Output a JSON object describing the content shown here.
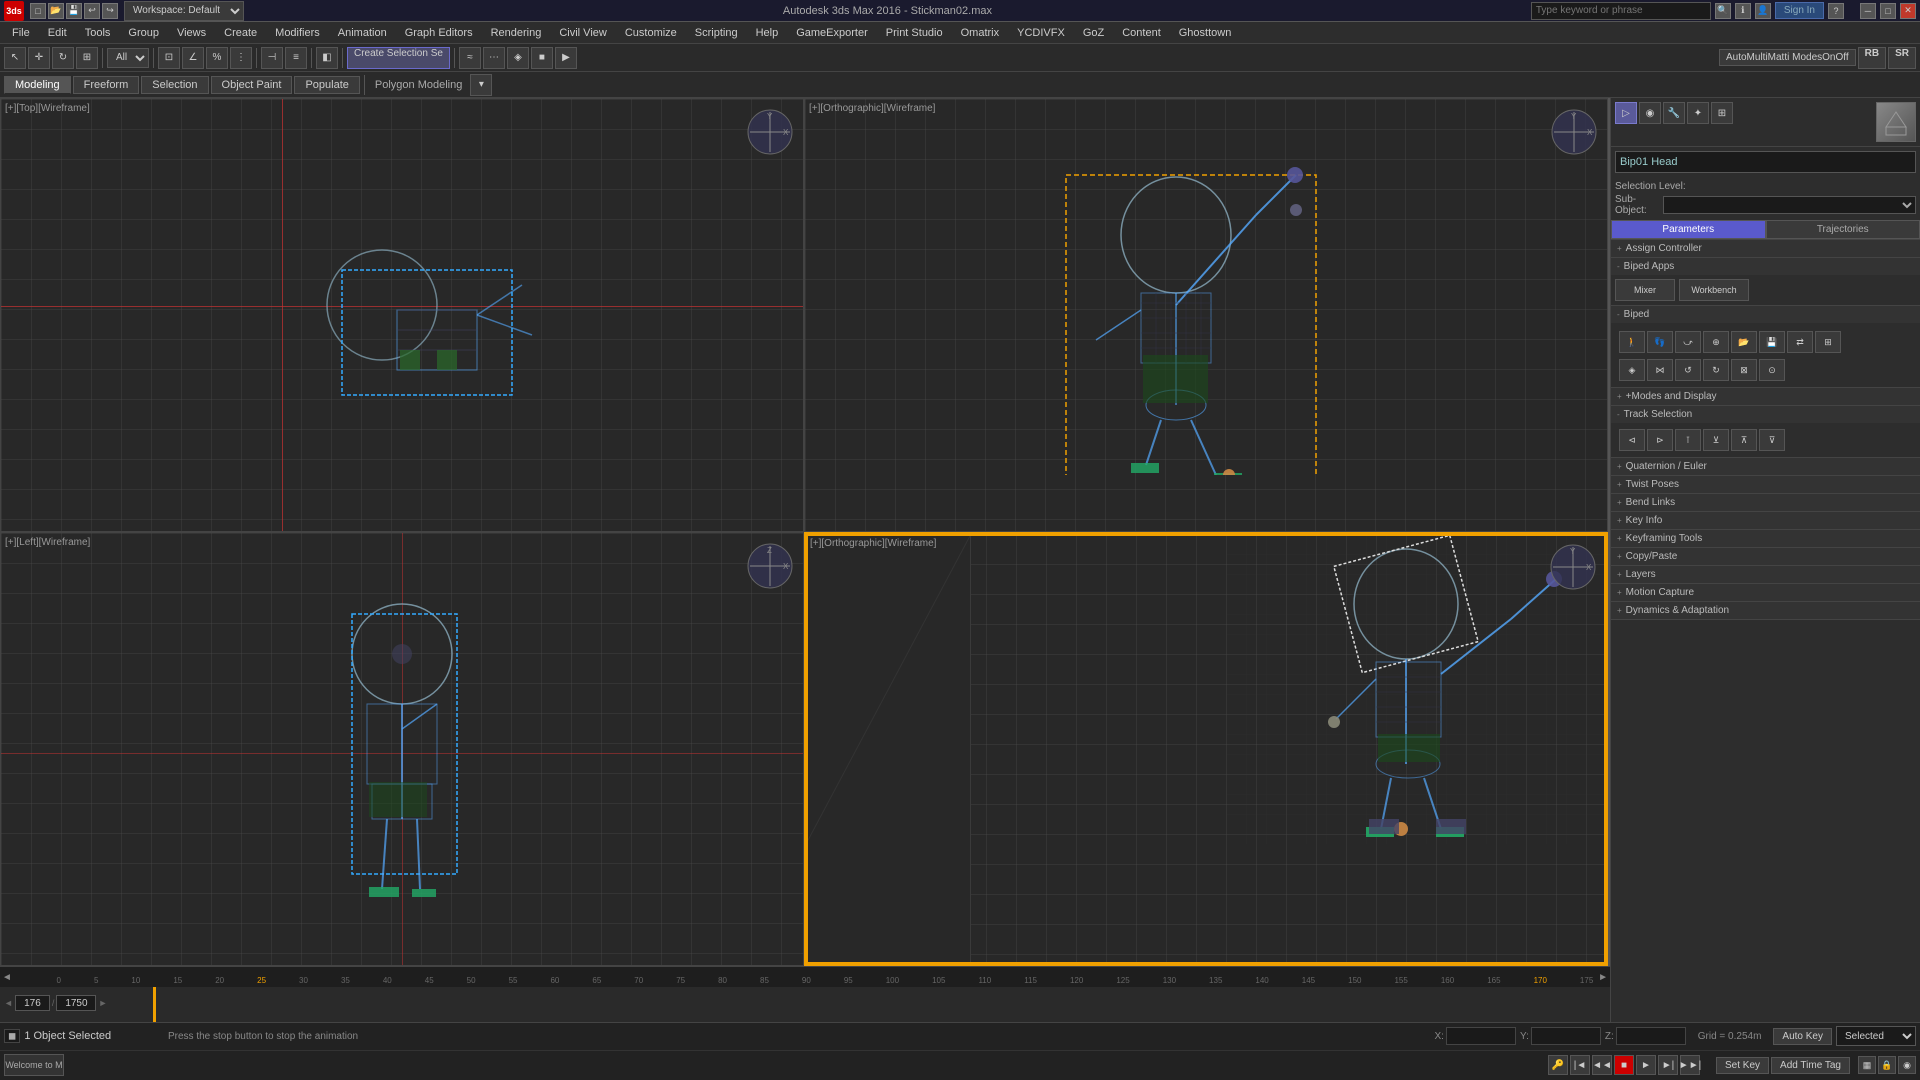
{
  "app": {
    "title": "Autodesk 3ds Max 2016 - Stickman02.max"
  },
  "titlebar": {
    "logo": "3ds",
    "workspace_label": "Workspace: Default",
    "search_placeholder": "Type keyword or phrase",
    "sign_in": "Sign In",
    "close": "✕",
    "maximize": "□",
    "minimize": "─",
    "help": "?"
  },
  "menubar": {
    "items": [
      "File",
      "Edit",
      "Tools",
      "Group",
      "Views",
      "Create",
      "Modifiers",
      "Animation",
      "Graph Editors",
      "Rendering",
      "Civil View",
      "Customize",
      "Scripting",
      "Help",
      "GameExporter",
      "Print Studio",
      "Omatrix",
      "YCDIVFX",
      "GoZ",
      "Content",
      "Ghosttown"
    ]
  },
  "toolbar": {
    "workspace": "Workspace: Default",
    "view_dropdown": "All",
    "create_selection": "Create Selection Se",
    "rb_btn": "RB",
    "sr_btn": "SR",
    "modes_btn": "AutoMultiMatti ModesOnOff"
  },
  "subtoolbar": {
    "tabs": [
      "Modeling",
      "Freeform",
      "Selection",
      "Object Paint",
      "Populate"
    ],
    "active_tab": "Modeling",
    "sub_label": "Polygon Modeling"
  },
  "viewports": [
    {
      "id": "vp-topleft",
      "label": "[+][Top][Wireframe]",
      "active": false,
      "position": "top-left"
    },
    {
      "id": "vp-topright",
      "label": "[+][Orthographic][Wireframe]",
      "active": false,
      "position": "top-right"
    },
    {
      "id": "vp-bottomleft",
      "label": "[+][Left][Wireframe]",
      "active": false,
      "position": "bottom-left"
    },
    {
      "id": "vp-bottomright",
      "label": "[+][Orthographic][Wireframe]",
      "active": true,
      "position": "bottom-right"
    }
  ],
  "right_panel": {
    "object_name": "Bip01 Head",
    "selection_level_label": "Selection Level:",
    "sub_object_label": "Sub-Object:",
    "tabs": [
      "Parameters",
      "Trajectories"
    ],
    "active_tab": "Parameters",
    "sections": [
      {
        "label": "Assign Controller",
        "expanded": false
      },
      {
        "label": "Biped Apps",
        "expanded": false
      },
      {
        "label": "Mixer",
        "expanded": false
      },
      {
        "label": "Workbench",
        "expanded": false
      },
      {
        "label": "Biped",
        "expanded": true
      },
      {
        "label": "+Modes and Display",
        "expanded": true
      },
      {
        "label": "Track Selection",
        "expanded": true
      },
      {
        "label": "Quaternion / Euler",
        "expanded": false
      },
      {
        "label": "Twist Poses",
        "expanded": false
      },
      {
        "label": "Bend Links",
        "expanded": false
      },
      {
        "label": "Key Info",
        "expanded": false
      },
      {
        "label": "Keyframing Tools",
        "expanded": false
      },
      {
        "label": "Copy/Paste",
        "expanded": false
      },
      {
        "label": "Layers",
        "expanded": false
      },
      {
        "label": "Motion Capture",
        "expanded": false
      },
      {
        "label": "Dynamics & Adaptation",
        "expanded": false
      }
    ]
  },
  "timeline": {
    "current_frame": "176",
    "total_frames": "1750",
    "ticks": [
      "0",
      "5",
      "10",
      "15",
      "20",
      "25",
      "30",
      "35",
      "40",
      "45",
      "50",
      "55",
      "60",
      "65",
      "70",
      "75",
      "80",
      "85",
      "90",
      "95",
      "100",
      "105",
      "110",
      "115",
      "120",
      "125",
      "130",
      "135",
      "140",
      "145",
      "150",
      "155",
      "160",
      "165",
      "170",
      "175"
    ]
  },
  "statusbar": {
    "object_selected": "1 Object Selected",
    "message": "Press the stop button to stop the animation",
    "x_label": "X:",
    "y_label": "Y:",
    "z_label": "Z:",
    "grid_info": "Grid = 0.254m",
    "auto_key": "Auto Key",
    "selected": "Selected",
    "set_key": "Set Key",
    "add_time_tag": "Add Time Tag"
  }
}
